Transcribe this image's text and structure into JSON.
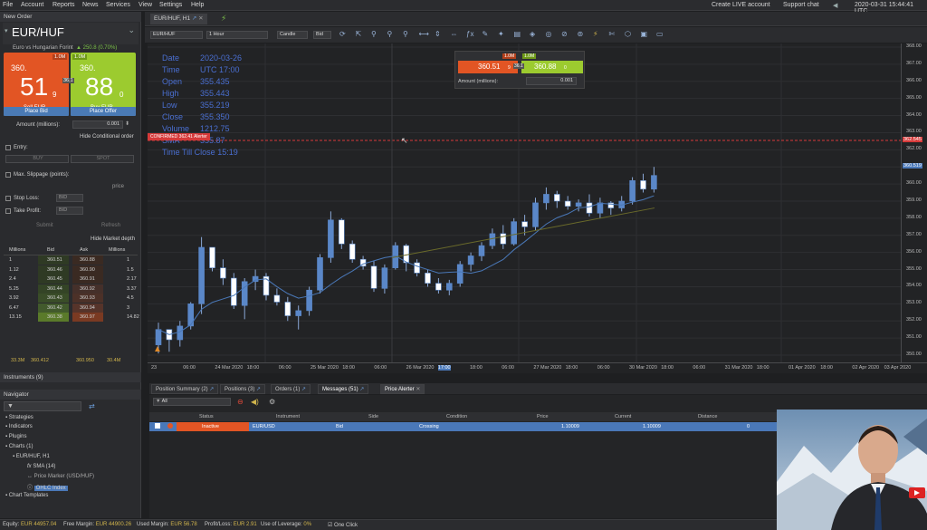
{
  "menu": {
    "items": [
      "File",
      "Account",
      "Reports",
      "News",
      "Services",
      "View",
      "Settings",
      "Help"
    ],
    "create_live": "Create LIVE account",
    "support": "Support chat",
    "datetime": "2020-03-31 15:44:41 UTC"
  },
  "new_order": {
    "title": "New Order",
    "symbol": "EUR/HUF",
    "description": "Euro vs Hungarian Forint",
    "change": "▲ 250.8 (0.70%)",
    "sell": {
      "prefix": "360.",
      "big": "51",
      "pip": "9",
      "label": "Sell EUR",
      "size": "1.0M"
    },
    "buy": {
      "prefix": "360.",
      "big": "88",
      "pip": "0",
      "label": "Buy EUR",
      "size": "1.0M"
    },
    "spread": "36.1",
    "place_bid": "Place Bid",
    "place_offer": "Place Offer",
    "amount_label": "Amount (millions):",
    "amount_value": "0.001",
    "hide_conditional": "Hide Conditional order",
    "entry_label": "Entry:",
    "buy_btn": "BUY",
    "sell_btn": "SPOT",
    "max_slippage": "Max. Slippage (points):",
    "price_label": "price",
    "stop_loss": "Stop Loss:",
    "take_profit": "Take Profit:",
    "bid_placeholder": "BID",
    "submit": "Submit",
    "refresh": "Refresh",
    "hide_depth": "Hide Market depth"
  },
  "depth": {
    "headers": [
      "Millions",
      "Bid",
      "Ask",
      "Millions"
    ],
    "rows": [
      [
        "1",
        "360.51",
        "360.88",
        "1"
      ],
      [
        "1.12",
        "360.46",
        "360.90",
        "1.5"
      ],
      [
        "2.4",
        "360.45",
        "360.91",
        "2.17"
      ],
      [
        "5.25",
        "360.44",
        "360.92",
        "3.37"
      ],
      [
        "3.92",
        "360.43",
        "360.93",
        "4.5"
      ],
      [
        "6.47",
        "360.42",
        "360.94",
        "3"
      ],
      [
        "13.15",
        "360.38",
        "360.97",
        "14.82"
      ]
    ],
    "total_bid": "33.3M",
    "avg_bid": "360.412",
    "avg_ask": "360.950",
    "total_ask": "30.4M"
  },
  "instruments": {
    "title": "Instruments (9)"
  },
  "navigator": {
    "title": "Navigator",
    "items": [
      "Strategies",
      "Indicators",
      "Plugins",
      "Charts (1)",
      "EUR/HUF, H1",
      "SMA (14)",
      "Price Marker (USD/HUF)",
      "OHLC Index",
      "Chart Templates"
    ]
  },
  "chart": {
    "tab": "EUR/HUF, H1",
    "instrument": "EUR/HUF",
    "period": "1 Hour",
    "type": "Candle",
    "side": "Bid",
    "ohlc": {
      "Date": "2020-03-26",
      "Time": "UTC 17:00",
      "Open": "355.435",
      "High": "355.443",
      "Low": "355.219",
      "Close": "355.350",
      "Volume": "1212.75",
      "SMA": "355.87",
      "Time Till Close": "15:19"
    },
    "overlay_sell": "360.51",
    "overlay_sell_pip": "9",
    "overlay_buy": "360.88",
    "overlay_buy_pip": "0",
    "overlay_size": "1.0M",
    "overlay_spread": "36.1",
    "overlay_amount_label": "Amount (millions):",
    "overlay_amount": "0.001",
    "price_line_label": "CONFIRMED 362.41 Alerter",
    "price_line_tag": "362.545",
    "current_tag": "360.519",
    "y_ticks": [
      "368.00",
      "367.00",
      "366.00",
      "365.00",
      "364.00",
      "363.00",
      "362.00",
      "361.00",
      "360.00",
      "359.00",
      "358.00",
      "357.00",
      "356.00",
      "355.00",
      "354.00",
      "353.00",
      "352.00",
      "351.00",
      "350.00"
    ],
    "x_ticks": [
      "23",
      "06:00",
      "24 Mar 2020",
      "18:00",
      "06:00",
      "25 Mar 2020",
      "18:00",
      "06:00",
      "26 Mar 2020",
      "17:00",
      "18:00",
      "06:00",
      "27 Mar 2020",
      "18:00",
      "06:00",
      "30 Mar 2020",
      "18:00",
      "06:00",
      "31 Mar 2020",
      "18:00",
      "01 Apr 2020",
      "18:00",
      "02 Apr 2020",
      "03 Apr 2020"
    ]
  },
  "chart_data": {
    "type": "candlestick",
    "x": [
      "23 Mar",
      "24 Mar",
      "25 Mar",
      "26 Mar",
      "27 Mar",
      "30 Mar",
      "31 Mar"
    ],
    "ylim": [
      350,
      368
    ],
    "candles": [
      [
        350.6,
        351.9,
        350.1,
        351.5
      ],
      [
        351.5,
        351.4,
        350.2,
        350.9
      ],
      [
        350.9,
        352.0,
        350.5,
        351.7
      ],
      [
        351.7,
        353.1,
        351.5,
        353.0
      ],
      [
        353.0,
        356.9,
        352.4,
        356.3
      ],
      [
        356.3,
        356.1,
        354.9,
        355.1
      ],
      [
        355.1,
        355.6,
        354.1,
        354.5
      ],
      [
        354.5,
        354.8,
        352.7,
        352.9
      ],
      [
        352.9,
        354.5,
        352.1,
        354.3
      ],
      [
        354.3,
        355.0,
        353.8,
        354.6
      ],
      [
        354.6,
        354.8,
        353.2,
        353.5
      ],
      [
        353.5,
        353.9,
        352.9,
        353.1
      ],
      [
        353.1,
        353.4,
        352.0,
        352.3
      ],
      [
        352.3,
        352.9,
        351.5,
        352.6
      ],
      [
        352.6,
        354.0,
        352.3,
        353.8
      ],
      [
        353.8,
        355.9,
        353.6,
        355.7
      ],
      [
        355.7,
        358.4,
        355.4,
        357.9
      ],
      [
        357.9,
        358.0,
        356.2,
        356.5
      ],
      [
        356.5,
        356.7,
        355.4,
        355.6
      ],
      [
        355.6,
        355.8,
        355.0,
        355.2
      ],
      [
        355.2,
        355.5,
        353.7,
        353.9
      ],
      [
        353.9,
        355.3,
        353.6,
        355.1
      ],
      [
        355.1,
        356.6,
        355.0,
        356.4
      ],
      [
        356.4,
        356.5,
        354.9,
        355.4
      ],
      [
        355.4,
        355.6,
        354.6,
        354.8
      ],
      [
        354.8,
        355.0,
        354.0,
        354.2
      ],
      [
        354.2,
        354.5,
        353.6,
        353.8
      ],
      [
        353.8,
        354.4,
        353.5,
        354.2
      ],
      [
        354.2,
        355.5,
        354.0,
        355.3
      ],
      [
        355.3,
        356.0,
        354.9,
        355.8
      ],
      [
        355.8,
        356.6,
        355.5,
        356.4
      ],
      [
        356.4,
        357.4,
        356.2,
        357.1
      ],
      [
        357.1,
        357.6,
        356.2,
        356.5
      ],
      [
        356.5,
        358.0,
        356.4,
        357.8
      ],
      [
        357.8,
        358.2,
        357.0,
        357.5
      ],
      [
        357.5,
        359.2,
        357.3,
        358.9
      ],
      [
        358.9,
        359.8,
        358.5,
        359.4
      ],
      [
        359.4,
        359.6,
        358.6,
        359.0
      ],
      [
        359.0,
        359.3,
        358.5,
        358.7
      ],
      [
        358.7,
        359.1,
        358.4,
        358.9
      ],
      [
        358.9,
        359.4,
        358.1,
        358.3
      ],
      [
        358.3,
        359.2,
        358.0,
        358.9
      ],
      [
        358.9,
        359.0,
        358.2,
        358.6
      ],
      [
        358.6,
        359.3,
        358.4,
        359.0
      ],
      [
        359.0,
        360.4,
        358.8,
        360.2
      ],
      [
        360.2,
        360.6,
        359.5,
        359.7
      ],
      [
        359.7,
        361.0,
        359.5,
        360.5
      ]
    ],
    "sma_label": "SMA (14)"
  },
  "alerter": {
    "tabs": [
      "Position Summary (2)",
      "Positions (3)",
      "Orders (1)",
      "Messages (51)",
      "Price Alerter"
    ],
    "filter": "All",
    "headers": [
      "Status",
      "Instrument",
      "Side",
      "Condition",
      "Price",
      "Current",
      "Distance"
    ],
    "rows": [
      [
        "Inactive",
        "EUR/USD",
        "Bid",
        "Crossing",
        "1.10009",
        "1.10009",
        "0"
      ]
    ]
  },
  "status": {
    "equity_label": "Equity:",
    "equity": "EUR 44957.04",
    "free_margin_label": "Free Margin:",
    "free_margin": "EUR 44900.26",
    "used_margin_label": "Used Margin:",
    "used_margin": "EUR 56.78",
    "profit_label": "Profit/Loss:",
    "profit": "EUR 2.91",
    "leverage_label": "Use of Leverage:",
    "leverage": "0%",
    "one_click": "One Click"
  },
  "colors": {
    "sell": "#e25524",
    "buy": "#9ccb2f",
    "candle": "#5a87c8",
    "alert_line": "#d63a3a",
    "row_highlight": "#4a78b8"
  }
}
